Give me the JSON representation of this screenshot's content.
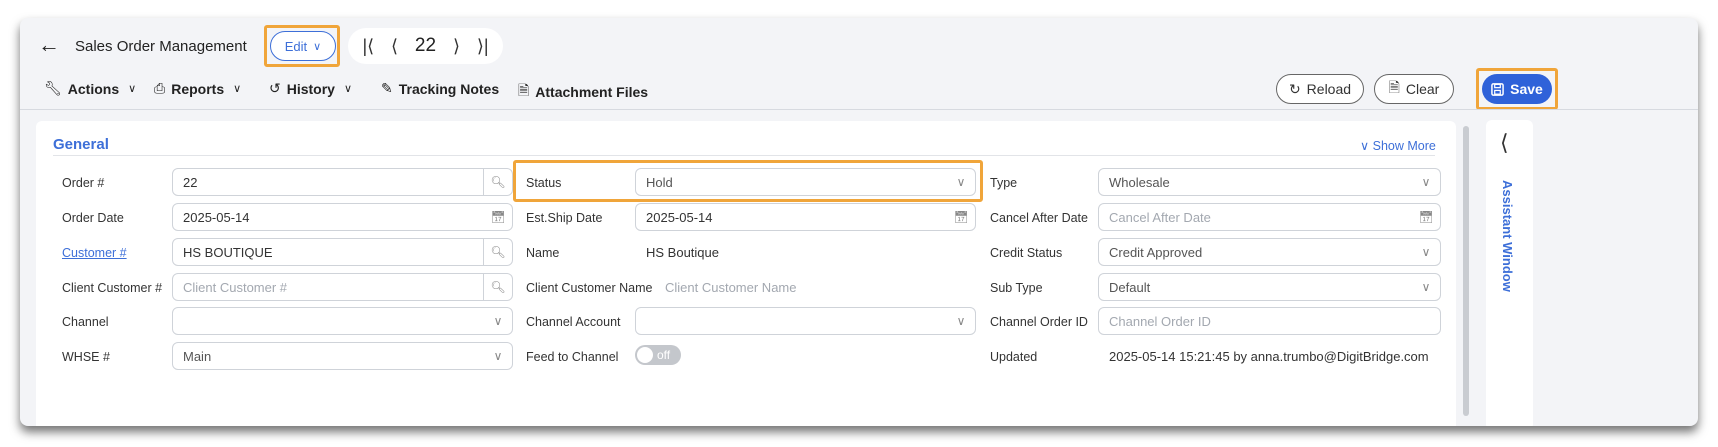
{
  "header": {
    "title": "Sales Order Management",
    "edit_label": "Edit",
    "record_number": "22"
  },
  "toolbar": {
    "actions": "Actions",
    "reports": "Reports",
    "history": "History",
    "tracking_notes": "Tracking Notes",
    "attachment_files": "Attachment Files",
    "reload": "Reload",
    "clear": "Clear",
    "save": "Save"
  },
  "general": {
    "section_title": "General",
    "show_more": "Show More"
  },
  "fields": {
    "order_num": {
      "label": "Order #",
      "value": "22"
    },
    "order_date": {
      "label": "Order Date",
      "value": "2025-05-14"
    },
    "customer_num": {
      "label": "Customer #",
      "value": "HS BOUTIQUE"
    },
    "client_customer_num": {
      "label": "Client Customer #",
      "placeholder": "Client Customer #"
    },
    "channel": {
      "label": "Channel",
      "value": ""
    },
    "whse": {
      "label": "WHSE #",
      "value": "Main"
    },
    "status": {
      "label": "Status",
      "value": "Hold"
    },
    "est_ship_date": {
      "label": "Est.Ship Date",
      "value": "2025-05-14"
    },
    "name": {
      "label": "Name",
      "value": "HS Boutique"
    },
    "client_customer_name": {
      "label": "Client Customer Name",
      "placeholder": "Client Customer Name"
    },
    "channel_account": {
      "label": "Channel Account",
      "value": ""
    },
    "feed_to_channel": {
      "label": "Feed to Channel",
      "state": "off"
    },
    "type": {
      "label": "Type",
      "value": "Wholesale"
    },
    "cancel_after_date": {
      "label": "Cancel After Date",
      "placeholder": "Cancel After Date"
    },
    "credit_status": {
      "label": "Credit Status",
      "value": "Credit Approved"
    },
    "sub_type": {
      "label": "Sub Type",
      "value": "Default"
    },
    "channel_order_id": {
      "label": "Channel Order ID",
      "placeholder": "Channel Order ID"
    },
    "updated": {
      "label": "Updated",
      "value": "2025-05-14 15:21:45 by anna.trumbo@DigitBridge.com"
    }
  },
  "assistant": {
    "label": "Assistant Window"
  },
  "colors": {
    "accent": "#3d6fd8",
    "save_bg": "#2f62d9",
    "highlight": "#f0a53a"
  }
}
